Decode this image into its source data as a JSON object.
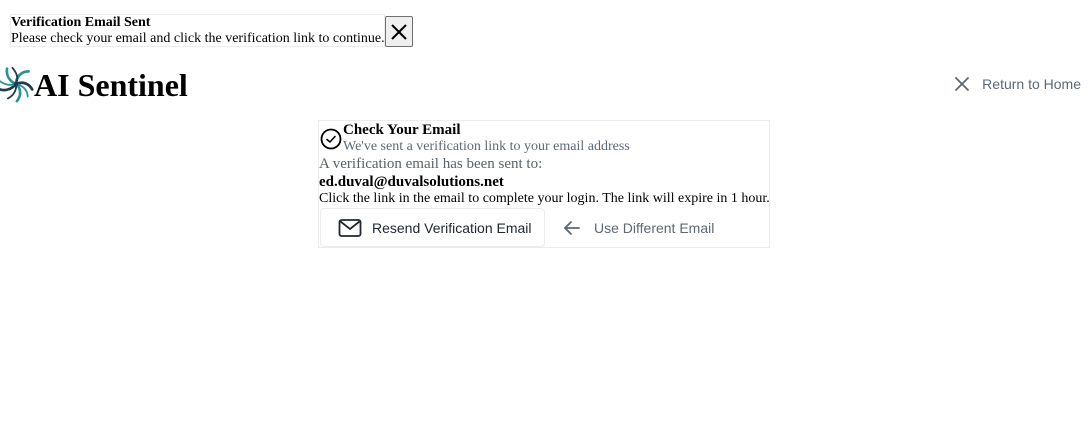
{
  "toast": {
    "title": "Verification Email Sent",
    "message": "Please check your email and click the verification link to continue."
  },
  "header": {
    "brand": "AI Sentinel",
    "logo_icon": "spiral-logo-icon",
    "return_home_label": "Return to Home"
  },
  "card": {
    "title": "Check Your Email",
    "subtitle": "We've sent a verification link to your email address",
    "sent_to_label": "A verification email has been sent to:",
    "email": "ed.duval@duvalsolutions.net",
    "instructions": "Click the link in the email to complete your login. The link will expire in 1 hour.",
    "resend_label": "Resend Verification Email",
    "different_email_label": "Use Different Email"
  },
  "colors": {
    "logo_teal": "#2f8f9a",
    "logo_dark": "#1f3c48",
    "muted_text": "#5e6873",
    "subtitle_text": "#5d6a7b",
    "border": "#ececec"
  }
}
